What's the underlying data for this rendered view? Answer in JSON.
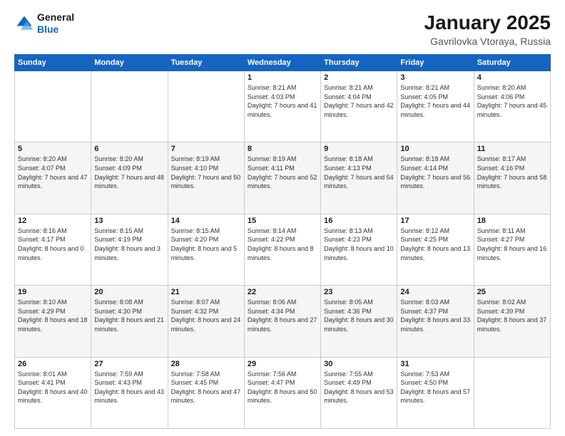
{
  "logo": {
    "line1": "General",
    "line2": "Blue"
  },
  "title": "January 2025",
  "subtitle": "Gavrilovka Vtoraya, Russia",
  "weekdays": [
    "Sunday",
    "Monday",
    "Tuesday",
    "Wednesday",
    "Thursday",
    "Friday",
    "Saturday"
  ],
  "weeks": [
    [
      {
        "day": "",
        "sunrise": "",
        "sunset": "",
        "daylight": ""
      },
      {
        "day": "",
        "sunrise": "",
        "sunset": "",
        "daylight": ""
      },
      {
        "day": "",
        "sunrise": "",
        "sunset": "",
        "daylight": ""
      },
      {
        "day": "1",
        "sunrise": "Sunrise: 8:21 AM",
        "sunset": "Sunset: 4:03 PM",
        "daylight": "Daylight: 7 hours and 41 minutes."
      },
      {
        "day": "2",
        "sunrise": "Sunrise: 8:21 AM",
        "sunset": "Sunset: 4:04 PM",
        "daylight": "Daylight: 7 hours and 42 minutes."
      },
      {
        "day": "3",
        "sunrise": "Sunrise: 8:21 AM",
        "sunset": "Sunset: 4:05 PM",
        "daylight": "Daylight: 7 hours and 44 minutes."
      },
      {
        "day": "4",
        "sunrise": "Sunrise: 8:20 AM",
        "sunset": "Sunset: 4:06 PM",
        "daylight": "Daylight: 7 hours and 45 minutes."
      }
    ],
    [
      {
        "day": "5",
        "sunrise": "Sunrise: 8:20 AM",
        "sunset": "Sunset: 4:07 PM",
        "daylight": "Daylight: 7 hours and 47 minutes."
      },
      {
        "day": "6",
        "sunrise": "Sunrise: 8:20 AM",
        "sunset": "Sunset: 4:09 PM",
        "daylight": "Daylight: 7 hours and 48 minutes."
      },
      {
        "day": "7",
        "sunrise": "Sunrise: 8:19 AM",
        "sunset": "Sunset: 4:10 PM",
        "daylight": "Daylight: 7 hours and 50 minutes."
      },
      {
        "day": "8",
        "sunrise": "Sunrise: 8:19 AM",
        "sunset": "Sunset: 4:11 PM",
        "daylight": "Daylight: 7 hours and 52 minutes."
      },
      {
        "day": "9",
        "sunrise": "Sunrise: 8:18 AM",
        "sunset": "Sunset: 4:13 PM",
        "daylight": "Daylight: 7 hours and 54 minutes."
      },
      {
        "day": "10",
        "sunrise": "Sunrise: 8:18 AM",
        "sunset": "Sunset: 4:14 PM",
        "daylight": "Daylight: 7 hours and 56 minutes."
      },
      {
        "day": "11",
        "sunrise": "Sunrise: 8:17 AM",
        "sunset": "Sunset: 4:16 PM",
        "daylight": "Daylight: 7 hours and 58 minutes."
      }
    ],
    [
      {
        "day": "12",
        "sunrise": "Sunrise: 8:16 AM",
        "sunset": "Sunset: 4:17 PM",
        "daylight": "Daylight: 8 hours and 0 minutes."
      },
      {
        "day": "13",
        "sunrise": "Sunrise: 8:15 AM",
        "sunset": "Sunset: 4:19 PM",
        "daylight": "Daylight: 8 hours and 3 minutes."
      },
      {
        "day": "14",
        "sunrise": "Sunrise: 8:15 AM",
        "sunset": "Sunset: 4:20 PM",
        "daylight": "Daylight: 8 hours and 5 minutes."
      },
      {
        "day": "15",
        "sunrise": "Sunrise: 8:14 AM",
        "sunset": "Sunset: 4:22 PM",
        "daylight": "Daylight: 8 hours and 8 minutes."
      },
      {
        "day": "16",
        "sunrise": "Sunrise: 8:13 AM",
        "sunset": "Sunset: 4:23 PM",
        "daylight": "Daylight: 8 hours and 10 minutes."
      },
      {
        "day": "17",
        "sunrise": "Sunrise: 8:12 AM",
        "sunset": "Sunset: 4:25 PM",
        "daylight": "Daylight: 8 hours and 13 minutes."
      },
      {
        "day": "18",
        "sunrise": "Sunrise: 8:11 AM",
        "sunset": "Sunset: 4:27 PM",
        "daylight": "Daylight: 8 hours and 16 minutes."
      }
    ],
    [
      {
        "day": "19",
        "sunrise": "Sunrise: 8:10 AM",
        "sunset": "Sunset: 4:29 PM",
        "daylight": "Daylight: 8 hours and 18 minutes."
      },
      {
        "day": "20",
        "sunrise": "Sunrise: 8:08 AM",
        "sunset": "Sunset: 4:30 PM",
        "daylight": "Daylight: 8 hours and 21 minutes."
      },
      {
        "day": "21",
        "sunrise": "Sunrise: 8:07 AM",
        "sunset": "Sunset: 4:32 PM",
        "daylight": "Daylight: 8 hours and 24 minutes."
      },
      {
        "day": "22",
        "sunrise": "Sunrise: 8:06 AM",
        "sunset": "Sunset: 4:34 PM",
        "daylight": "Daylight: 8 hours and 27 minutes."
      },
      {
        "day": "23",
        "sunrise": "Sunrise: 8:05 AM",
        "sunset": "Sunset: 4:36 PM",
        "daylight": "Daylight: 8 hours and 30 minutes."
      },
      {
        "day": "24",
        "sunrise": "Sunrise: 8:03 AM",
        "sunset": "Sunset: 4:37 PM",
        "daylight": "Daylight: 8 hours and 33 minutes."
      },
      {
        "day": "25",
        "sunrise": "Sunrise: 8:02 AM",
        "sunset": "Sunset: 4:39 PM",
        "daylight": "Daylight: 8 hours and 37 minutes."
      }
    ],
    [
      {
        "day": "26",
        "sunrise": "Sunrise: 8:01 AM",
        "sunset": "Sunset: 4:41 PM",
        "daylight": "Daylight: 8 hours and 40 minutes."
      },
      {
        "day": "27",
        "sunrise": "Sunrise: 7:59 AM",
        "sunset": "Sunset: 4:43 PM",
        "daylight": "Daylight: 8 hours and 43 minutes."
      },
      {
        "day": "28",
        "sunrise": "Sunrise: 7:58 AM",
        "sunset": "Sunset: 4:45 PM",
        "daylight": "Daylight: 8 hours and 47 minutes."
      },
      {
        "day": "29",
        "sunrise": "Sunrise: 7:56 AM",
        "sunset": "Sunset: 4:47 PM",
        "daylight": "Daylight: 8 hours and 50 minutes."
      },
      {
        "day": "30",
        "sunrise": "Sunrise: 7:55 AM",
        "sunset": "Sunset: 4:49 PM",
        "daylight": "Daylight: 8 hours and 53 minutes."
      },
      {
        "day": "31",
        "sunrise": "Sunrise: 7:53 AM",
        "sunset": "Sunset: 4:50 PM",
        "daylight": "Daylight: 8 hours and 57 minutes."
      },
      {
        "day": "",
        "sunrise": "",
        "sunset": "",
        "daylight": ""
      }
    ]
  ]
}
